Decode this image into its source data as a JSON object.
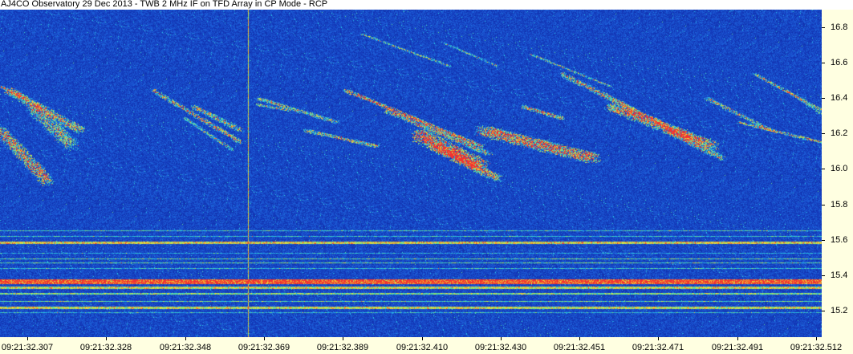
{
  "title": "AJ4CO Observatory 29 Dec 2013 - TWB 2 MHz IF on TFD Array in CP Mode - RCP",
  "y_axis": {
    "labels": [
      "16.8",
      "16.6",
      "16.4",
      "16.2",
      "16.0",
      "15.8",
      "15.6",
      "15.4",
      "15.2"
    ],
    "min": 15.05,
    "max": 16.9
  },
  "x_axis": {
    "labels": [
      "09:21:32.307",
      "09:21:32.328",
      "09:21:32.348",
      "09:21:32.369",
      "09:21:32.389",
      "09:21:32.410",
      "09:21:32.430",
      "09:21:32.451",
      "09:21:32.471",
      "09:21:32.491",
      "09:21:32.512"
    ]
  },
  "colors": {
    "background": "#1a3fb4",
    "axis_bg": "#ffffe1"
  }
}
